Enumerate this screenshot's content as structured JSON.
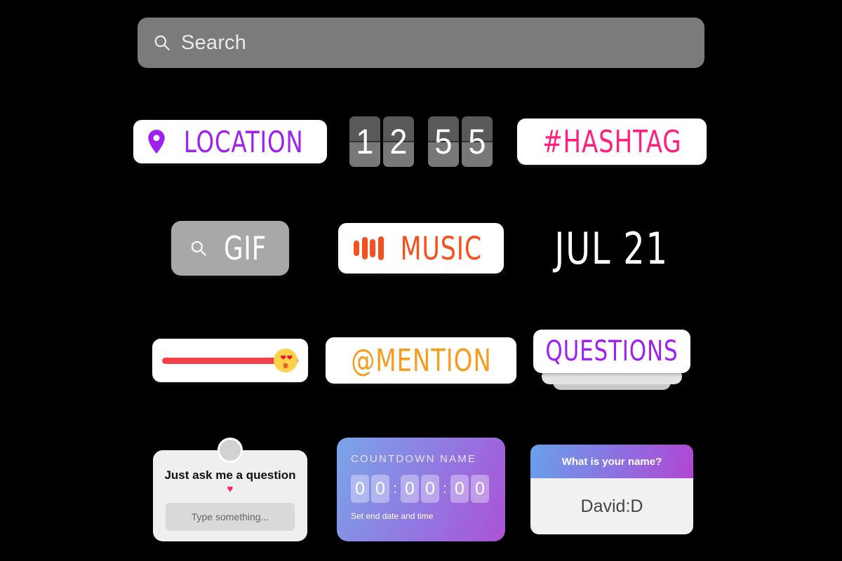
{
  "search": {
    "placeholder": "Search",
    "icon": "search-icon"
  },
  "stickers": {
    "location": {
      "label": "LOCATION",
      "icon": "location-pin-icon",
      "color": "#a020f0"
    },
    "time": {
      "digits": [
        "1",
        "2",
        "5",
        "5"
      ],
      "value": "12 55"
    },
    "hashtag": {
      "label": "#HASHTAG",
      "color": "#ff1f7d"
    },
    "gif": {
      "label": "GIF",
      "icon": "search-icon",
      "color": "#a8a8a8"
    },
    "music": {
      "label": "MUSIC",
      "icon": "equalizer-icon",
      "color": "#f4511e"
    },
    "date": {
      "label": "JUL 21",
      "color": "#ffffff"
    },
    "slider": {
      "emoji": "heart-eyes-emoji",
      "track_color": "#f5424a",
      "value": "100"
    },
    "mention": {
      "label": "@MENTION",
      "color": "#f89c1c"
    },
    "questions": {
      "label": "QUESTIONS",
      "color": "#a020f0"
    },
    "question_box": {
      "title": "Just ask me a question",
      "heart": "♥",
      "input_placeholder": "Type something...",
      "avatar": "avatar-placeholder"
    },
    "countdown": {
      "name": "COUNTDOWN NAME",
      "digits": [
        "0",
        "0",
        "0",
        "0",
        "0",
        "0"
      ],
      "separator": ":",
      "footer": "Set end date and time",
      "gradient_from": "#7aa5e8",
      "gradient_to": "#ab52d6"
    },
    "quiz": {
      "question": "What is your name?",
      "answer": "David:D",
      "gradient_from": "#6aa0ea",
      "gradient_to": "#b246d3"
    }
  }
}
